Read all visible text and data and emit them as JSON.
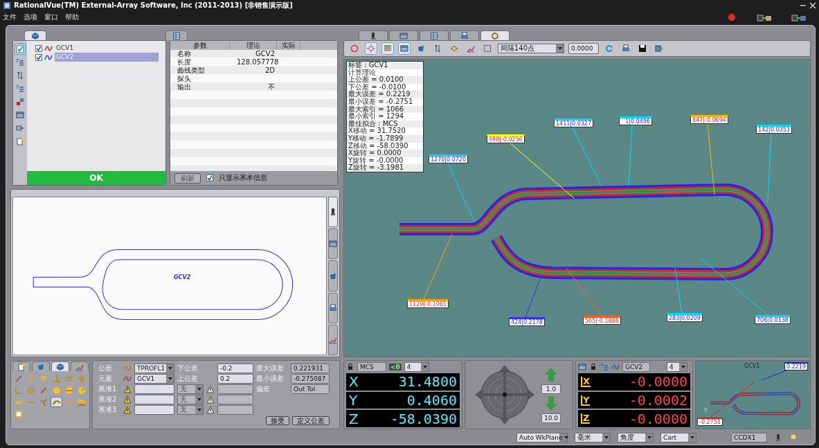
{
  "window": {
    "title": "RationalVue(TM) External-Array Software, Inc (2011-2013) [非销售演示版]"
  },
  "menu": [
    "文件",
    "选项",
    "窗口",
    "帮助"
  ],
  "left_tabs": [
    {
      "selected": true
    },
    {
      "selected": false
    }
  ],
  "side_tools": [
    {
      "selected": true
    },
    {
      "selected": false
    },
    {
      "selected": false
    },
    {
      "selected": false
    },
    {
      "selected": false
    },
    {
      "selected": false
    },
    {
      "selected": false
    },
    {
      "selected": false
    }
  ],
  "feature_tree": {
    "items": [
      {
        "label": "GCV1",
        "checked": true,
        "selected": false,
        "color": "#d03030"
      },
      {
        "label": "GCV2",
        "checked": true,
        "selected": true,
        "color": "#3050c0"
      }
    ],
    "ok_button": "OK"
  },
  "params": {
    "columns": [
      "参数",
      "理论",
      "实际"
    ],
    "rows": [
      {
        "name": "名称",
        "theory": "GCV2"
      },
      {
        "name": "长度",
        "theory": "128.057778"
      },
      {
        "name": "曲线类型",
        "theory": "2D"
      },
      {
        "name": "探头"
      },
      {
        "name": "输出",
        "theory": "不"
      }
    ],
    "refresh_button": {
      "label": "刷新",
      "disabled": true
    },
    "basic_only": {
      "label": "只显示基本信息",
      "checked": true
    }
  },
  "preview": {
    "label": "GCV2",
    "side_tabs": [
      {
        "selected": true
      },
      {
        "selected": false
      },
      {
        "selected": false
      },
      {
        "selected": false
      },
      {
        "selected": false
      }
    ]
  },
  "graph_tabs": [
    {
      "selected": false
    },
    {
      "selected": false
    },
    {
      "selected": false
    },
    {
      "selected": false
    },
    {
      "selected": true
    }
  ],
  "graph_toolbar": {
    "interval": "间隔140点",
    "value": "0.0000"
  },
  "info_box": [
    "标签 : GCV1",
    "计算理论",
    "上公差 = 0.0100",
    "下公差 = -0.0100",
    "最大误差 = 0.2219",
    "最小误差 = -0.2751",
    "最大索引 = 1066",
    "最小索引 = 1294",
    "最佳拟合 : MCS",
    "X移动 = 31.7520",
    "Y移动 = -1.7899",
    "Z移动 = -58.0390",
    "X旋转 = 0.0000",
    "Y旋转 = -0.0000",
    "Z旋转 = -3.1981"
  ],
  "callouts": [
    {
      "label": "1270|0.0720",
      "color": "#00d8ff",
      "negative": false
    },
    {
      "label": "988|-0.0256",
      "color": "#ffff00",
      "negative": true
    },
    {
      "label": "1411|0.0327",
      "color": "#00d8ff",
      "negative": false
    },
    {
      "label": "1|0.0496",
      "color": "#00d8ff",
      "negative": false
    },
    {
      "label": "847|-0.0694",
      "color": "#ffb400",
      "negative": true
    },
    {
      "label": "142|0.0353",
      "color": "#00d8ff",
      "negative": false
    },
    {
      "label": "1129|-0.1065",
      "color": "#ffa000",
      "negative": true
    },
    {
      "label": "424|0.2178",
      "color": "#3030ff",
      "negative": false
    },
    {
      "label": "565|-0.1886",
      "color": "#ff6020",
      "negative": true
    },
    {
      "label": "283|0.0209",
      "color": "#00d8ff",
      "negative": false
    },
    {
      "label": "706|0.0138",
      "color": "#00d8ff",
      "negative": false
    }
  ],
  "tool_tabs": [
    {
      "selected": false
    },
    {
      "selected": false
    },
    {
      "selected": true
    },
    {
      "selected": false
    }
  ],
  "tool_palette": [
    {
      "selected": false
    },
    {
      "selected": false
    },
    {
      "selected": false
    },
    {
      "selected": false
    },
    {
      "selected": false
    },
    {
      "selected": false
    },
    {
      "selected": false
    },
    {
      "selected": false
    },
    {
      "selected": false
    },
    {
      "selected": false
    },
    {
      "selected": false
    },
    {
      "selected": false
    },
    {
      "selected": false
    },
    {
      "selected": false
    },
    {
      "selected": false
    },
    {
      "selected": true
    },
    {
      "selected": false
    },
    {
      "selected": false
    },
    {
      "selected": false
    }
  ],
  "tolerance": {
    "type_label": "公差",
    "type": "TPROFL1",
    "element_label": "元素",
    "element": "GCV1",
    "datums": [
      {
        "label": "基准1",
        "modifier": "无"
      },
      {
        "label": "基准2",
        "modifier": "无"
      },
      {
        "label": "基准3",
        "modifier": "无"
      }
    ],
    "lower_label": "下公差",
    "lower": "-0.2",
    "upper_label": "上公差",
    "upper": "0.2",
    "max_label": "最大误差",
    "max": "0.221931",
    "min_label": "最小误差",
    "min": "-0.275087",
    "deviation_label": "偏差",
    "deviation": "Out Tol",
    "buttons": [
      "接受",
      "定义公差"
    ]
  },
  "dro": {
    "frame": "MCS",
    "zero_mark": "<0",
    "precision": "4",
    "axes": [
      {
        "axis": "X",
        "value": "31.4800"
      },
      {
        "axis": "Y",
        "value": "0.4060"
      },
      {
        "axis": "Z",
        "value": "-58.0390"
      }
    ]
  },
  "jog": {
    "step": "1.0",
    "speed": "10.0"
  },
  "error_dro": {
    "feature": "GCV2",
    "precision": "4",
    "axes": [
      {
        "axis": "X",
        "value": "-0.0000"
      },
      {
        "axis": "Y",
        "value": "-0.0002"
      },
      {
        "axis": "Z",
        "value": "-0.0000"
      }
    ]
  },
  "mini_graph": {
    "title": "GCV1",
    "max": "0.2219",
    "min": "-0.2751",
    "axis_label": "Y"
  },
  "status_bar": {
    "workplane": "Auto WkPlane",
    "units": "毫米",
    "angle": "角度",
    "coords": "Cart",
    "camera": "CCDX1"
  }
}
